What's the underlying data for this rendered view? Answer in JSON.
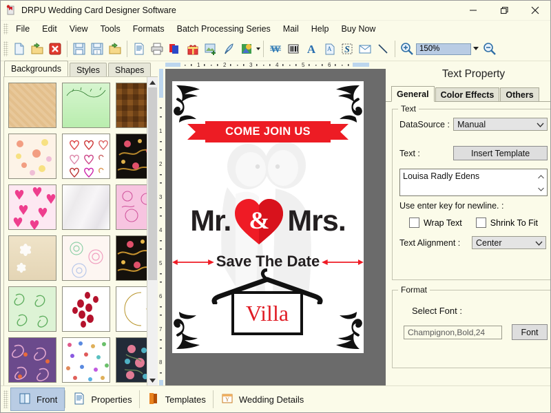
{
  "window": {
    "title": "DRPU Wedding Card Designer Software",
    "app_icon": "app-icon",
    "minimize": "–",
    "maximize": "□",
    "close": "×"
  },
  "menubar": {
    "items": [
      {
        "label": "File"
      },
      {
        "label": "Edit"
      },
      {
        "label": "View"
      },
      {
        "label": "Tools"
      },
      {
        "label": "Formats"
      },
      {
        "label": "Batch Processing Series"
      },
      {
        "label": "Mail"
      },
      {
        "label": "Help"
      },
      {
        "label": "Buy Now"
      }
    ]
  },
  "toolbar": {
    "icons": [
      "new-document-icon",
      "open-folder-icon",
      "close-document-icon",
      "save-icon",
      "save-as-icon",
      "open-template-icon",
      "page-setup-icon",
      "print-icon",
      "copy-layers-icon",
      "gift-icon",
      "insert-image-icon",
      "pen-icon",
      "shapes-icon",
      "watermark-icon",
      "barcode-icon",
      "text-icon",
      "text-box-icon",
      "signature-icon",
      "email-icon",
      "line-icon"
    ],
    "zoom_in_icon": "zoom-in-icon",
    "zoom_out_icon": "zoom-out-icon",
    "zoom_value": "150%",
    "zoom_dropdown_icon": "chevron-down-icon"
  },
  "left_panel": {
    "tabs": [
      {
        "label": "Backgrounds",
        "active": true
      },
      {
        "label": "Styles",
        "active": false
      },
      {
        "label": "Shapes",
        "active": false
      }
    ],
    "scroll_up_icon": "chevron-up-icon",
    "scroll_down_icon": "chevron-down-icon",
    "thumbnails": [
      {
        "name": "bg-tan-weave"
      },
      {
        "name": "bg-green-vine"
      },
      {
        "name": "bg-brown-tile"
      },
      {
        "name": "bg-peach-blossom"
      },
      {
        "name": "bg-white-hearts"
      },
      {
        "name": "bg-black-floral"
      },
      {
        "name": "bg-pink-hearts"
      },
      {
        "name": "bg-white-silk"
      },
      {
        "name": "bg-pink-doodle"
      },
      {
        "name": "bg-cream-flowers"
      },
      {
        "name": "bg-pastel-mandala"
      },
      {
        "name": "bg-black-gold-floral"
      },
      {
        "name": "bg-green-paisley"
      },
      {
        "name": "bg-red-petals"
      },
      {
        "name": "bg-gold-moon-star"
      },
      {
        "name": "bg-purple-paisley"
      },
      {
        "name": "bg-multicolor-ditsy"
      },
      {
        "name": "bg-navy-rose"
      }
    ]
  },
  "canvas": {
    "h_ruler_labels": [
      "1",
      "2",
      "3",
      "4",
      "5",
      "6"
    ],
    "v_ruler_labels": [
      "1",
      "2",
      "3",
      "4",
      "5",
      "6",
      "7",
      "8"
    ],
    "card": {
      "ribbon_text": "COME JOIN US",
      "title_left": "Mr.",
      "title_right": "Mrs.",
      "ampersand": "&",
      "subtitle": "Save The Date",
      "venue": "Villa",
      "accent_red": "#ed1c24",
      "ink_black": "#231f20",
      "venue_red": "#e01b24"
    }
  },
  "right_panel": {
    "title": "Text Property",
    "tabs": [
      {
        "label": "General",
        "active": true
      },
      {
        "label": "Color Effects",
        "active": false
      },
      {
        "label": "Others",
        "active": false
      }
    ],
    "text_group": {
      "legend": "Text",
      "datasource_label": "DataSource :",
      "datasource_value": "Manual",
      "datasource_dropdown_icon": "chevron-down-icon",
      "text_label": "Text :",
      "insert_template_button": "Insert Template",
      "text_value": "Louisa Radly Edens",
      "textarea_up_icon": "chevron-up-icon",
      "textarea_down_icon": "chevron-down-icon",
      "hint": "Use enter key for newline. :",
      "wrap_text_label": "Wrap Text",
      "wrap_text_checked": false,
      "shrink_to_fit_label": "Shrink To Fit",
      "shrink_to_fit_checked": false,
      "alignment_label": "Text Alignment :",
      "alignment_value": "Center",
      "alignment_dropdown_icon": "chevron-down-icon"
    },
    "format_group": {
      "legend": "Format",
      "select_font_label": "Select Font :",
      "font_value": "Champignon,Bold,24",
      "font_button": "Font"
    }
  },
  "bottom_bar": {
    "items": [
      {
        "label": "Front",
        "icon": "front-card-icon",
        "active": true
      },
      {
        "label": "Properties",
        "icon": "properties-icon",
        "active": false
      },
      {
        "label": "Templates",
        "icon": "templates-icon",
        "active": false
      },
      {
        "label": "Wedding Details",
        "icon": "wedding-details-icon",
        "active": false
      }
    ]
  }
}
